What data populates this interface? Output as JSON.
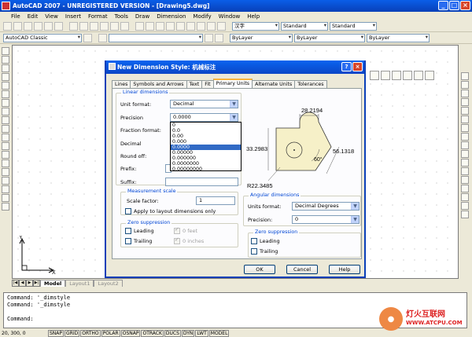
{
  "app": {
    "title": "AutoCAD 2007 - UNREGISTERED VERSION - [Drawing5.dwg]",
    "menu": [
      "File",
      "Edit",
      "View",
      "Insert",
      "Format",
      "Tools",
      "Draw",
      "Dimension",
      "Modify",
      "Window",
      "Help"
    ],
    "workspace": "AutoCAD Classic",
    "text_style": "Standard",
    "dim_style": "Standard",
    "layer_color": "ByLayer",
    "linetype": "ByLayer",
    "lineweight": "ByLayer",
    "font_name": "汉字"
  },
  "layout_tabs": [
    "Model",
    "Layout1",
    "Layout2"
  ],
  "command_lines": [
    "Command: '_dimstyle",
    "Command: '_dimstyle",
    "",
    "Command:"
  ],
  "status": {
    "coords": "20, 300, 0",
    "buttons": [
      "SNAP",
      "GRID",
      "ORTHO",
      "POLAR",
      "OSNAP",
      "OTRACK",
      "DUCS",
      "DYN",
      "LWT",
      "MODEL"
    ]
  },
  "ucs": {
    "x_label": "X",
    "y_label": "Y"
  },
  "watermark": {
    "brand": "灯火互联网",
    "url": "WWW.ATCPU.COM"
  },
  "dialog": {
    "title": "New Dimension Style: 机械标注",
    "tabs": [
      "Lines",
      "Symbols and Arrows",
      "Text",
      "Fit",
      "Primary Units",
      "Alternate Units",
      "Tolerances"
    ],
    "active_tab": "Primary Units",
    "linear": {
      "group_title": "Linear dimensions",
      "unit_format_label": "Unit format:",
      "unit_format_value": "Decimal",
      "precision_label": "Precision",
      "precision_value": "0.0000",
      "precision_options": [
        "0",
        "0.0",
        "0.00",
        "0.000",
        "0.0000",
        "0.00000",
        "0.000000",
        "0.0000000",
        "0.00000000"
      ],
      "fraction_label": "Fraction format:",
      "decimal_label": "Decimal",
      "roundoff_label": "Round off:",
      "prefix_label": "Prefix:",
      "suffix_label": "Suffix:"
    },
    "measurement": {
      "group_title": "Measurement scale",
      "scale_label": "Scale factor:",
      "scale_value": "1",
      "apply_layout_label": "Apply to layout dimensions only"
    },
    "zero_linear": {
      "group_title": "Zero suppression",
      "leading": "Leading",
      "trailing": "Trailing",
      "feet": "0 feet",
      "inches": "0 inches"
    },
    "angular": {
      "group_title": "Angular dimensions",
      "units_label": "Units format:",
      "units_value": "Decimal Degrees",
      "precision_label": "Precision:",
      "precision_value": "0"
    },
    "zero_angular": {
      "group_title": "Zero suppression",
      "leading": "Leading",
      "trailing": "Trailing"
    },
    "preview": {
      "dim_top": "28.2194",
      "dim_left": "33.2983",
      "dim_right": "56.1318",
      "dim_angle": "60°",
      "dim_radius": "R22.3485"
    },
    "buttons": {
      "ok": "OK",
      "cancel": "Cancel",
      "help": "Help"
    }
  }
}
